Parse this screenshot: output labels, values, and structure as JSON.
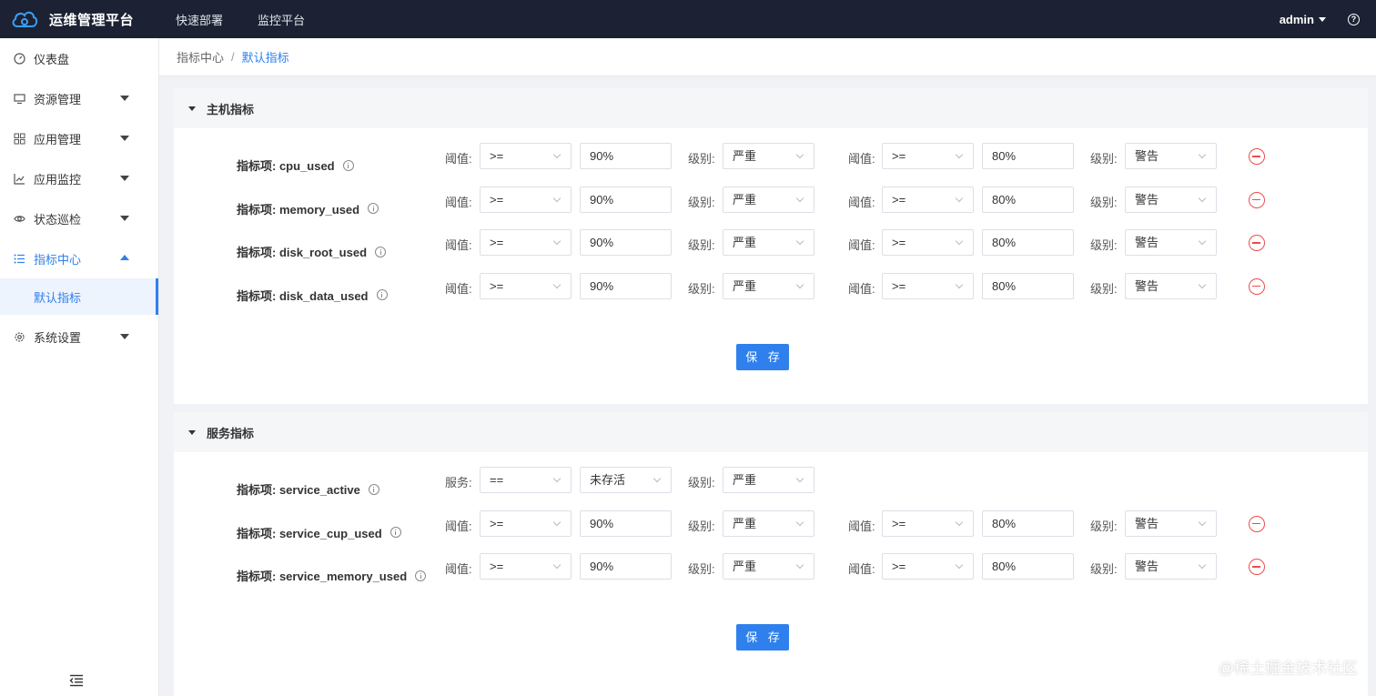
{
  "brand": {
    "title": "运维管理平台",
    "logo_icon": "cloud-logo-icon",
    "accent": "#2f80ed"
  },
  "topnav": [
    "快速部署",
    "监控平台"
  ],
  "user": {
    "name": "admin"
  },
  "sidebar": {
    "items": [
      {
        "label": "仪表盘",
        "icon": "dashboard-icon"
      },
      {
        "label": "资源管理",
        "icon": "monitor-icon"
      },
      {
        "label": "应用管理",
        "icon": "grid-icon"
      },
      {
        "label": "应用监控",
        "icon": "chart-line-icon"
      },
      {
        "label": "状态巡检",
        "icon": "eye-icon"
      },
      {
        "label": "指标中心",
        "icon": "list-icon"
      },
      {
        "label": "系统设置",
        "icon": "gear-icon"
      }
    ],
    "submenu": {
      "label": "默认指标"
    }
  },
  "breadcrumb": {
    "parent": "指标中心",
    "separator": "/",
    "current": "默认指标"
  },
  "host_panel": {
    "title": "主机指标",
    "save_label": "保 存",
    "rows": [
      {
        "label": "指标项: cpu_used",
        "l1": "阈值:",
        "op1": ">=",
        "v1": "90%",
        "lv1_label": "级别:",
        "lv1": "严重",
        "l2": "阈值:",
        "op2": ">=",
        "v2": "80%",
        "lv2_label": "级别:",
        "lv2": "警告"
      },
      {
        "label": "指标项: memory_used",
        "l1": "阈值:",
        "op1": ">=",
        "v1": "90%",
        "lv1_label": "级别:",
        "lv1": "严重",
        "l2": "阈值:",
        "op2": ">=",
        "v2": "80%",
        "lv2_label": "级别:",
        "lv2": "警告"
      },
      {
        "label": "指标项: disk_root_used",
        "l1": "阈值:",
        "op1": ">=",
        "v1": "90%",
        "lv1_label": "级别:",
        "lv1": "严重",
        "l2": "阈值:",
        "op2": ">=",
        "v2": "80%",
        "lv2_label": "级别:",
        "lv2": "警告"
      },
      {
        "label": "指标项: disk_data_used",
        "l1": "阈值:",
        "op1": ">=",
        "v1": "90%",
        "lv1_label": "级别:",
        "lv1": "严重",
        "l2": "阈值:",
        "op2": ">=",
        "v2": "80%",
        "lv2_label": "级别:",
        "lv2": "警告"
      }
    ]
  },
  "service_panel": {
    "title": "服务指标",
    "save_label": "保 存",
    "rows": [
      {
        "label": "指标项: service_active",
        "l1": "服务:",
        "op1": "==",
        "v1": "未存活",
        "lv1_label": "级别:",
        "lv1": "严重"
      },
      {
        "label": "指标项: service_cup_used",
        "l1": "阈值:",
        "op1": ">=",
        "v1": "90%",
        "lv1_label": "级别:",
        "lv1": "严重",
        "l2": "阈值:",
        "op2": ">=",
        "v2": "80%",
        "lv2_label": "级别:",
        "lv2": "警告"
      },
      {
        "label": "指标项: service_memory_used",
        "l1": "阈值:",
        "op1": ">=",
        "v1": "90%",
        "lv1_label": "级别:",
        "lv1": "严重",
        "l2": "阈值:",
        "op2": ">=",
        "v2": "80%",
        "lv2_label": "级别:",
        "lv2": "警告"
      }
    ]
  },
  "watermark": "@稀土掘金技术社区"
}
